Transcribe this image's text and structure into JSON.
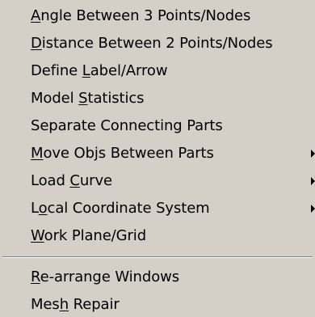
{
  "menu": {
    "items": [
      {
        "pre": "",
        "key": "A",
        "post": "ngle Between 3 Points/Nodes",
        "submenu": false
      },
      {
        "pre": "",
        "key": "D",
        "post": "istance Between 2 Points/Nodes",
        "submenu": false
      },
      {
        "pre": "Define ",
        "key": "L",
        "post": "abel/Arrow",
        "submenu": false
      },
      {
        "pre": "Model ",
        "key": "S",
        "post": "tatistics",
        "submenu": false
      },
      {
        "pre": "Separate Connecting Parts",
        "key": "",
        "post": "",
        "submenu": false
      },
      {
        "pre": "",
        "key": "M",
        "post": "ove Objs Between Parts",
        "submenu": true
      },
      {
        "pre": "Load ",
        "key": "C",
        "post": "urve",
        "submenu": true
      },
      {
        "pre": "L",
        "key": "o",
        "post": "cal Coordinate System",
        "submenu": true
      },
      {
        "pre": "",
        "key": "W",
        "post": "ork Plane/Grid",
        "submenu": false
      }
    ],
    "items_after_separator": [
      {
        "pre": "",
        "key": "R",
        "post": "e-arrange Windows",
        "submenu": false
      },
      {
        "pre": "Mes",
        "key": "h",
        "post": " Repair",
        "submenu": false
      }
    ]
  }
}
